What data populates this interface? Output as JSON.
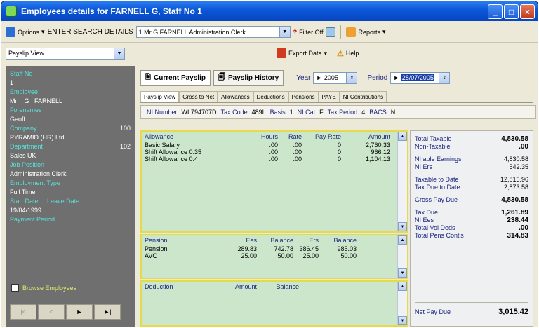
{
  "window": {
    "title": "Employees details for FARNELL G, Staff No 1"
  },
  "toolbar": {
    "options_label": "Options",
    "search_label": "ENTER SEARCH DETAILS",
    "search_value": "1 Mr G FARNELL Administration Clerk",
    "filter_label": "Filter Off",
    "reports_label": "Reports"
  },
  "view_select": {
    "value": "Payslip View"
  },
  "export": {
    "label": "Export Data"
  },
  "help": {
    "label": "Help"
  },
  "employee": {
    "staff_no_label": "Staff No",
    "staff_no": "1",
    "employee_label": "Employee",
    "title": "Mr",
    "initial": "G",
    "surname": "FARNELL",
    "forenames_label": "Forenames",
    "forenames": "Geoff",
    "company_label": "Company",
    "company_code": "100",
    "company": "PYRAMID (HR) Ltd",
    "department_label": "Department",
    "department_code": "102",
    "department": "Sales UK",
    "job_label": "Job Position",
    "job": "Administration Clerk",
    "emptype_label": "Employment Type",
    "emptype": "Full Time",
    "start_label": "Start Date",
    "leave_label": "Leave Date",
    "start_date": "19/04/1999",
    "payment_label": "Payment Period",
    "browse_label": "Browse Employees"
  },
  "nav": {
    "first": "|<",
    "prev": "<",
    "next": "►",
    "last": "►|"
  },
  "tabs": {
    "current": "Current Payslip",
    "history": "Payslip History",
    "year_label": "Year",
    "year_value": "2005",
    "period_label": "Period",
    "period_value": "28/07/2005"
  },
  "subtabs": [
    "Payslip View",
    "Gross to Net",
    "Allowances",
    "Deductions",
    "Pensions",
    "PAYE",
    "NI Contributions"
  ],
  "ni_info": {
    "ni_number_label": "NI Number",
    "ni_number": "WL794707D",
    "tax_code_label": "Tax Code",
    "tax_code": "489L",
    "basis_label": "Basis",
    "basis": "1",
    "ni_cat_label": "NI Cat",
    "ni_cat": "F",
    "tax_period_label": "Tax Period",
    "tax_period": "4",
    "bacs_label": "BACS",
    "bacs": "N"
  },
  "allowances": {
    "headers": [
      "Allowance",
      "Hours",
      "Rate",
      "Pay Rate",
      "Amount"
    ],
    "rows": [
      [
        "Basic Salary",
        ".00",
        ".00",
        "0",
        "2,760.33"
      ],
      [
        "Shift Allowance 0.35",
        ".00",
        ".00",
        "0",
        "966.12"
      ],
      [
        "Shift Allowance 0.4",
        ".00",
        ".00",
        "0",
        "1,104.13"
      ]
    ]
  },
  "pensions": {
    "headers": [
      "Pension",
      "Ees",
      "Balance",
      "Ers",
      "Balance"
    ],
    "rows": [
      [
        "Pension",
        "289.83",
        "742.78",
        "386.45",
        "985.03"
      ],
      [
        "AVC",
        "25.00",
        "50.00",
        "25.00",
        "50.00"
      ]
    ]
  },
  "deductions": {
    "headers": [
      "Deduction",
      "Amount",
      "Balance"
    ]
  },
  "summary": [
    {
      "label": "Total Taxable",
      "value": "4,830.58",
      "bold": true
    },
    {
      "label": "Non-Taxable",
      "value": ".00",
      "bold": true
    },
    {
      "label": "",
      "value": "",
      "bold": false
    },
    {
      "label": "NI able Earnings",
      "value": "4,830.58",
      "bold": false
    },
    {
      "label": "NI Ers",
      "value": "542.35",
      "bold": false
    },
    {
      "label": "",
      "value": "",
      "bold": false
    },
    {
      "label": "Taxable to Date",
      "value": "12,816.96",
      "bold": false
    },
    {
      "label": "Tax Due to Date",
      "value": "2,873.58",
      "bold": false
    },
    {
      "label": "",
      "value": "",
      "bold": false
    },
    {
      "label": "Gross Pay Due",
      "value": "4,830.58",
      "bold": true
    },
    {
      "label": "",
      "value": "",
      "bold": false
    },
    {
      "label": "Tax Due",
      "value": "1,261.89",
      "bold": true
    },
    {
      "label": "NI Ees",
      "value": "238.44",
      "bold": true
    },
    {
      "label": "Total Vol Deds",
      "value": ".00",
      "bold": true
    },
    {
      "label": "Total Pens Cont's",
      "value": "314.83",
      "bold": true
    }
  ],
  "net_pay": {
    "label": "Net Pay Due",
    "value": "3,015.42"
  }
}
